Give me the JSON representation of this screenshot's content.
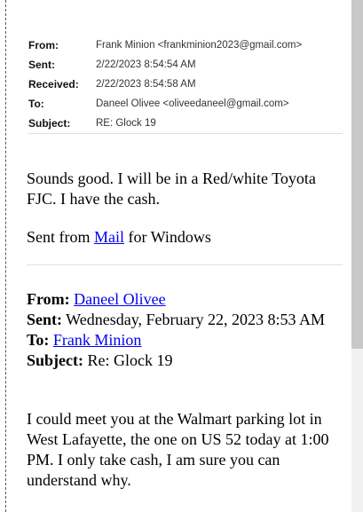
{
  "header": {
    "from_label": "From:",
    "from_value": "Frank Minion <frankminion2023@gmail.com>",
    "sent_label": "Sent:",
    "sent_value": "2/22/2023 8:54:54 AM",
    "received_label": "Received:",
    "received_value": "2/22/2023 8:54:58 AM",
    "to_label": "To:",
    "to_value": "Daneel Olivee <oliveedaneel@gmail.com>",
    "subject_label": "Subject:",
    "subject_value": "RE: Glock 19"
  },
  "reply": {
    "line1": "Sounds good. I will be in a Red/white Toyota FJC. I have the cash.",
    "sent_from_prefix": "Sent from ",
    "sent_from_link": "Mail",
    "sent_from_suffix": " for Windows"
  },
  "quoted": {
    "from_label": "From:",
    "from_name": "Daneel Olivee",
    "sent_label": "Sent:",
    "sent_value": " Wednesday, February 22, 2023 8:53 AM",
    "to_label": "To:",
    "to_name": "Frank Minion",
    "subject_label": "Subject:",
    "subject_value": " Re: Glock 19",
    "message": "I could meet you at the Walmart parking lot in West Lafayette, the one on US 52 today at 1:00 PM. I only take cash, I am sure you can understand why."
  }
}
